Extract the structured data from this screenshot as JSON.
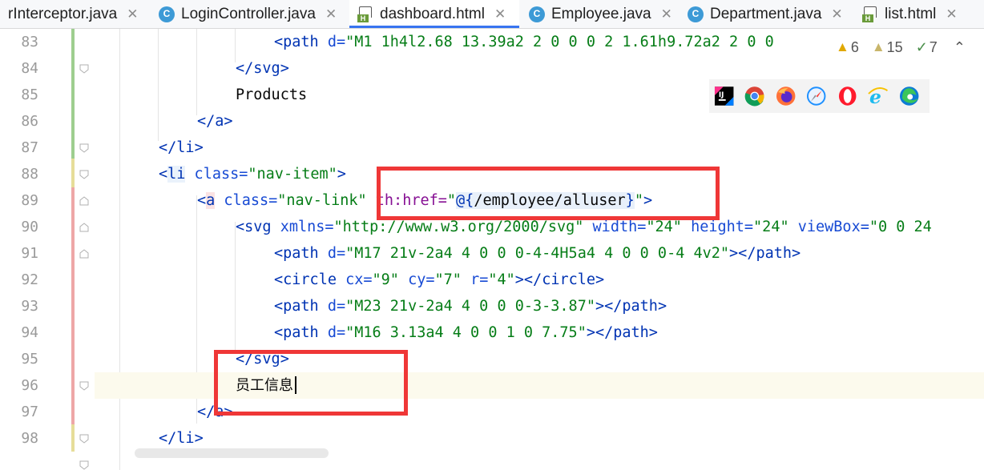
{
  "tabs": [
    {
      "label": "rInterceptor.java",
      "icon": "none",
      "active": false
    },
    {
      "label": "LoginController.java",
      "icon": "class-icon",
      "active": false
    },
    {
      "label": "dashboard.html",
      "icon": "html-icon",
      "active": true
    },
    {
      "label": "Employee.java",
      "icon": "class-icon",
      "active": false
    },
    {
      "label": "Department.java",
      "icon": "class-icon",
      "active": false
    },
    {
      "label": "list.html",
      "icon": "html-icon",
      "active": false
    }
  ],
  "close_glyph": "✕",
  "chevron": "⌄",
  "inspection": {
    "warnings": "6",
    "weak_warnings": "15",
    "ok": "7",
    "up": "⌃",
    "down": "⌄"
  },
  "class_glyph": "C",
  "html_glyph": "H",
  "line_numbers": [
    "83",
    "84",
    "85",
    "86",
    "87",
    "88",
    "89",
    "90",
    "91",
    "92",
    "93",
    "94",
    "95",
    "96",
    "97",
    "98"
  ],
  "code": {
    "l83": {
      "open": "<path ",
      "a1": "d=",
      "s1": "\"M1 1h4l2.68 13.39a2 2 0 0 0 2 1.61h9.72a2 2 0 0"
    },
    "l84": {
      "t": "</svg>"
    },
    "l85": {
      "t": "Products"
    },
    "l86": {
      "o": "</",
      "n": "a",
      "c": ">"
    },
    "l87": {
      "o": "</",
      "n": "li",
      "c": ">"
    },
    "l88": {
      "o": "<",
      "n": "li",
      "a1": " class=",
      "s1": "\"nav-item\"",
      "c": ">"
    },
    "l89": {
      "o": "<",
      "n": "a",
      "a1": " class=",
      "s1": "\"nav-link\"",
      "th": " th:href=",
      "s2a": "\"",
      "s2b": "@{",
      "s2c": "/employee/alluser",
      "s2d": "}",
      "s2e": "\"",
      "c": ">"
    },
    "l90": {
      "o": "<svg ",
      "a1": "xmlns=",
      "s1": "\"http://www.w3.org/2000/svg\"",
      "a2": " width=",
      "s2": "\"24\"",
      "a3": " height=",
      "s3": "\"24\"",
      "a4": " viewBox=",
      "s4": "\"0 0 24"
    },
    "l91": {
      "o": "<path ",
      "a1": "d=",
      "s1": "\"M17 21v-2a4 4 0 0 0-4-4H5a4 4 0 0 0-4 4v2\"",
      "c": "></path>"
    },
    "l92": {
      "o": "<circle ",
      "a1": "cx=",
      "s1": "\"9\"",
      "a2": " cy=",
      "s2": "\"7\"",
      "a3": " r=",
      "s3": "\"4\"",
      "c": "></circle>"
    },
    "l93": {
      "o": "<path ",
      "a1": "d=",
      "s1": "\"M23 21v-2a4 4 0 0 0-3-3.87\"",
      "c": "></path>"
    },
    "l94": {
      "o": "<path ",
      "a1": "d=",
      "s1": "\"M16 3.13a4 4 0 0 1 0 7.75\"",
      "c": "></path>"
    },
    "l95": {
      "t": "</svg>"
    },
    "l96": {
      "t": "员工信息"
    },
    "l97": {
      "o": "</",
      "n": "a",
      "c": ">"
    },
    "l98": {
      "o": "</",
      "n": "li",
      "c": ">"
    }
  },
  "colors": {
    "tag": "#0033b3",
    "attr": "#174ad4",
    "string": "#067d17",
    "thymeleaf": "#871094",
    "highlight_box": "#ef3737",
    "active_tab": "#3874f0"
  }
}
